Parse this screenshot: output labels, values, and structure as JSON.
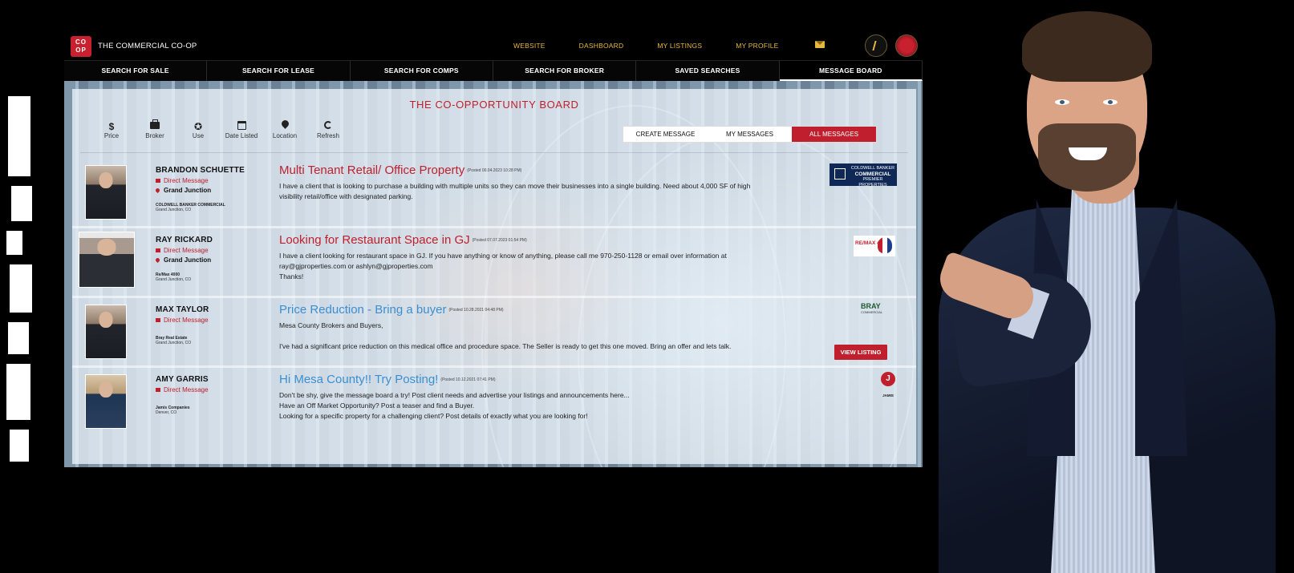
{
  "app": {
    "brand_logo": "CO OP",
    "brand_name": "THE COMMERCIAL CO-OP"
  },
  "top_links": [
    "WEBSITE",
    "DASHBOARD",
    "MY LISTINGS",
    "MY PROFILE"
  ],
  "icons": {
    "mail": "mail-icon",
    "profile": "profile-avatar-icon",
    "account": "account-avatar-icon"
  },
  "nav": [
    "SEARCH FOR SALE",
    "SEARCH FOR LEASE",
    "SEARCH FOR COMPS",
    "SEARCH FOR BROKER",
    "SAVED SEARCHES",
    "MESSAGE BOARD"
  ],
  "nav_active": "MESSAGE BOARD",
  "board": {
    "title": "THE CO-OPPORTUNITY BOARD",
    "filters": [
      {
        "label": "Price",
        "icon": "dollar-icon"
      },
      {
        "label": "Broker",
        "icon": "briefcase-icon"
      },
      {
        "label": "Use",
        "icon": "star-icon"
      },
      {
        "label": "Date Listed",
        "icon": "calendar-icon"
      },
      {
        "label": "Location",
        "icon": "location-pin-icon"
      },
      {
        "label": "Refresh",
        "icon": "refresh-icon"
      }
    ],
    "message_tabs": [
      "CREATE MESSAGE",
      "MY MESSAGES",
      "ALL MESSAGES"
    ],
    "active_tab": "ALL MESSAGES"
  },
  "posts": [
    {
      "name": "BRANDON SCHUETTE",
      "direct_message": "Direct Message",
      "location": "Grand Junction",
      "company": "COLDWELL BANKER COMMERCIAL",
      "company_location": "Grand Junction, CO",
      "headline": "Multi Tenant Retail/ Office Property",
      "posted": "(Posted 00.04.2023 10:28 PM)",
      "body": "I have a client that is looking to purchase a building with multiple units so they can move their businesses into a single building. Need about 4,000 SF of high visibility retail/office with designated parking.",
      "logo": {
        "line1": "COLDWELL BANKER",
        "line2": "COMMERCIAL",
        "line3": "PREMIER PROPERTIES"
      }
    },
    {
      "name": "RAY RICKARD",
      "direct_message": "Direct Message",
      "location": "Grand Junction",
      "company": "Re/Max 4000",
      "company_location": "Grand Junction, CO",
      "headline": "Looking for Restaurant Space in GJ",
      "posted": "(Posted 07.07.2023 01:54 PM)",
      "body_lines": [
        "I have a client looking for restaurant space in GJ. If you have anything or know of anything, please call me 970-250-1128 or email over information at",
        "ray@gjproperties.com or ashlyn@gjproperties.com",
        "Thanks!"
      ],
      "logo": {
        "text": "RE/MAX 4000"
      }
    },
    {
      "name": "MAX TAYLOR",
      "direct_message": "Direct Message",
      "company": "Bray Real Estate",
      "company_location": "Grand Junction, CO",
      "headline": "Price Reduction - Bring a buyer",
      "posted": "(Posted 10.28.2021 04:48 PM)",
      "body_lines": [
        "Mesa County Brokers and Buyers,",
        "",
        "I've had a significant price reduction on this medical office and procedure space. The Seller is ready to get this one moved. Bring an offer and lets talk."
      ],
      "logo": {
        "text": "BRAY",
        "sub": "COMMERCIAL"
      },
      "action": "VIEW LISTING"
    },
    {
      "name": "AMY GARRIS",
      "direct_message": "Direct Message",
      "company": "Jamis Companies",
      "company_location": "Denver, CO",
      "headline": "Hi Mesa County!! Try Posting!",
      "posted": "(Posted 10.12.2021 07:41 PM)",
      "body_lines": [
        "Don't be shy, give the message board a try!  Post client needs and advertise your listings and announcements here...",
        "Have an Off Market Opportunity? Post a teaser and find a Buyer.",
        "Looking for a specific property for a challenging client?  Post details of exactly what you are looking for!"
      ],
      "logo": {
        "letter": "J",
        "text": "JAMIS"
      }
    }
  ],
  "colors": {
    "accent": "#c0202d",
    "gold": "#e6b843",
    "link_blue": "#3b8fd0",
    "background": "#000000"
  }
}
